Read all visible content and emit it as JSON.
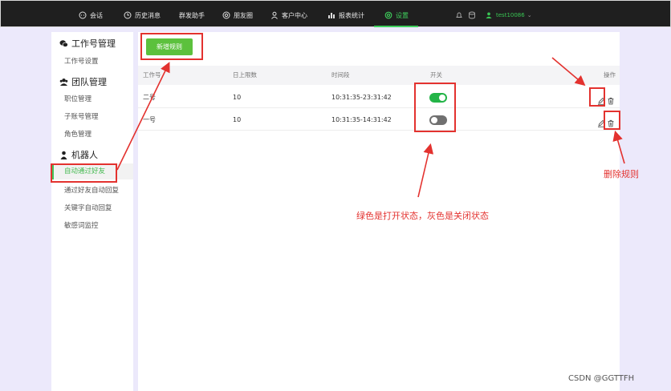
{
  "nav": {
    "items": [
      {
        "label": "会话",
        "icon": "chat-icon"
      },
      {
        "label": "历史消息",
        "icon": "clock-icon"
      },
      {
        "label": "群发助手",
        "icon": ""
      },
      {
        "label": "朋友圈",
        "icon": "moments-icon"
      },
      {
        "label": "客户中心",
        "icon": "user-icon"
      },
      {
        "label": "报表统计",
        "icon": "bar-chart-icon"
      },
      {
        "label": "设置",
        "icon": "settings-icon",
        "active": true
      }
    ],
    "username": "test10086",
    "accent_color": "#3fcf5c"
  },
  "sidebar": {
    "groups": [
      {
        "title": "工作号管理",
        "icon": "wechat-icon",
        "items": [
          "工作号设置"
        ]
      },
      {
        "title": "团队管理",
        "icon": "team-icon",
        "items": [
          "职位管理",
          "子账号管理",
          "角色管理"
        ]
      },
      {
        "title": "机器人",
        "icon": "robot-icon",
        "items": [
          "自动通过好友",
          "通过好友自动回复",
          "关键字自动回复",
          "敏感词监控"
        ]
      }
    ],
    "active_item": "自动通过好友"
  },
  "main": {
    "add_button": "新增规则",
    "columns": [
      "工作号",
      "日上限数",
      "时间段",
      "开关",
      "操作"
    ],
    "rows": [
      {
        "account": "二号",
        "limit": "10",
        "period": "10:31:35-23:31:42",
        "enabled": true
      },
      {
        "account": "一号",
        "limit": "10",
        "period": "10:31:35-14:31:42",
        "enabled": false
      }
    ]
  },
  "annotations": {
    "toggle_note": "绿色是打开状态，灰色是关闭状态",
    "delete_note": "删除规则",
    "color": "#e3322f"
  },
  "watermark": "CSDN @GGTTFH"
}
